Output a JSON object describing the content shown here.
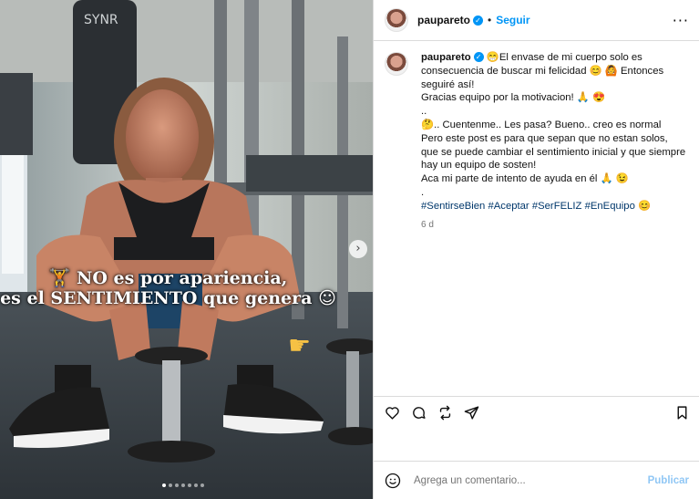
{
  "photo": {
    "overlay_line1": "NO es por apariencia,",
    "overlay_line1_emoji": "🏋",
    "overlay_line2": "es el SENTIMIENTO que genera",
    "overlay_line2_emoji": "☺",
    "bag_text": "SYNR",
    "carousel_dots": 7,
    "active_dot": 1
  },
  "header": {
    "username": "paupareto",
    "separator": "•",
    "follow_label": "Seguir",
    "more_label": "···"
  },
  "caption": {
    "username": "paupareto",
    "line1": "😁El envase de mi cuerpo solo es consecuencia de buscar mi felicidad 😊 🙆 Entonces seguiré así!",
    "line2": "Gracias equipo por la motivacion! 🙏 😍",
    "line3": "..",
    "line4": "🤔.. Cuentenme.. Les pasa? Bueno.. creo es normal",
    "line5": "Pero este post es para que sepan que no estan solos, que se puede cambiar el sentimiento inicial y que siempre hay un equipo de sosten!",
    "line6": "Aca mi parte de intento de ayuda en él 🙏 😉",
    "line7": ".",
    "hashtags": "#SentirseBien #Aceptar #SerFELIZ #EnEquipo 😊",
    "time": "6 d"
  },
  "composer": {
    "placeholder": "Agrega un comentario...",
    "post_label": "Publicar"
  },
  "icons": [
    "heart-icon",
    "comment-icon",
    "repost-icon",
    "share-icon",
    "bookmark-icon",
    "emoji-icon",
    "verified-icon"
  ],
  "colors": {
    "accent": "#0095f6",
    "border": "#dbdbdb",
    "muted": "#737373",
    "hashtag": "#00376b"
  }
}
